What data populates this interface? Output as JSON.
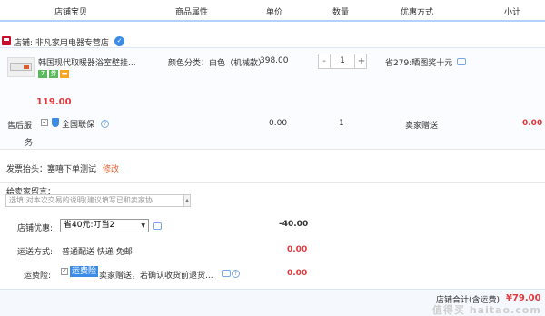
{
  "header": {
    "cols": [
      "店铺宝贝",
      "商品属性",
      "单价",
      "数量",
      "优惠方式",
      "小计"
    ]
  },
  "shop": {
    "label": "店铺: 非凡家用电器专营店",
    "verified_glyph": "✓"
  },
  "product": {
    "title": "韩国现代取暖器浴室壁挂...",
    "badges": [
      {
        "text": "7",
        "color": "#5cb85c"
      },
      {
        "text": "券",
        "color": "#5cb85c"
      },
      {
        "text": "▬",
        "color": "#f5a623"
      }
    ],
    "attr": "颜色分类：白色（机械款）",
    "unit_price": "398.00",
    "quantity": "1",
    "qty_minus": "-",
    "qty_plus": "+",
    "promo": "省279:晒图奖十元",
    "promo_price": "119.00"
  },
  "after_sales": {
    "label_line1": "售后服",
    "label_line2": "务",
    "checkbox": "✓",
    "service": "全国联保",
    "price": "0.00",
    "quantity": "1",
    "promo": "卖家赠送",
    "subtotal": "0.00"
  },
  "invoice": {
    "label": "发票抬头：塞嘻下单测试",
    "edit": "修改"
  },
  "message": {
    "label": "给卖家留言：",
    "placeholder": "选填:对本次交易的说明(建议填写已和卖家协"
  },
  "discount": {
    "label": "店铺优惠:",
    "selected": "省40元:叮当2",
    "arrow": "▼",
    "amount": "-40.00"
  },
  "shipping": {
    "label": "运送方式:",
    "value": "普通配送 快递 免邮",
    "amount": "0.00"
  },
  "insurance": {
    "label": "运费险:",
    "checkbox": "✓",
    "tag": "运费险",
    "text": "卖家赠送，若确认收货前退货...",
    "amount": "0.00"
  },
  "total": {
    "label": "店铺合计(含运费)",
    "amount": "¥79.00"
  },
  "watermark": "值得买 haitao.com",
  "colors": {
    "accent": "#3c8ce7",
    "price_red": "#e4393c",
    "header_border": "#b2d1ff"
  }
}
